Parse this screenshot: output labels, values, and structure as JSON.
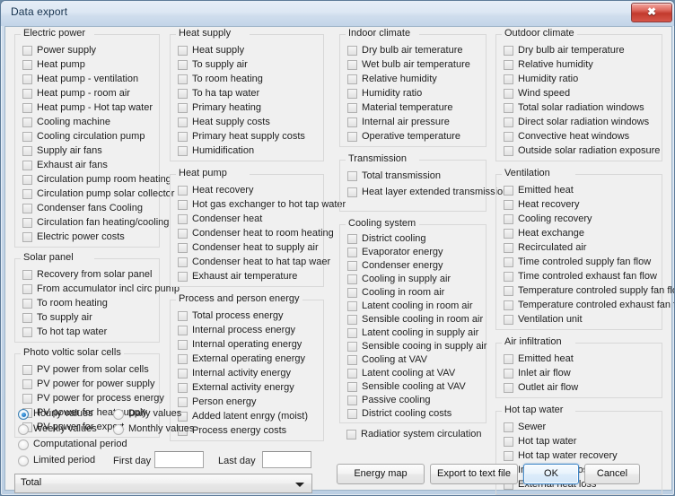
{
  "window": {
    "title": "Data export",
    "close_label": "✖",
    "close_icon": "close-icon"
  },
  "groups": {
    "electric_power": {
      "title": "Electric power",
      "items": [
        "Power supply",
        "Heat pump",
        "Heat pump - ventilation",
        "Heat pump - room air",
        "Heat pump - Hot tap water",
        "Cooling machine",
        "Cooling circulation pump",
        "Supply air fans",
        "Exhaust air fans",
        "Circulation pump room heating",
        "Circulation pump solar collector",
        "Condenser fans Cooling",
        "Circulation fan heating/cooling",
        "Electric power costs"
      ]
    },
    "solar_panel": {
      "title": "Solar panel",
      "items": [
        "Recovery from solar panel",
        "From accumulator incl circ pump",
        "To room heating",
        "To supply air",
        "To hot tap water"
      ]
    },
    "photo_voltic": {
      "title": "Photo voltic solar cells",
      "items": [
        "PV power from solar cells",
        "PV power for power supply",
        "PV power for process energy",
        "PV power for heat supply",
        "PV power for export"
      ]
    },
    "heat_supply": {
      "title": "Heat supply",
      "items": [
        "Heat supply",
        "To supply air",
        "To room heating",
        "To ha tap water",
        "Primary heating",
        "Heat supply costs",
        "Primary heat supply costs",
        "Humidification"
      ]
    },
    "heat_pump": {
      "title": "Heat pump",
      "items": [
        "Heat recovery",
        "Hot gas exchanger to hot tap water",
        "Condenser heat",
        "Condenser heat to room heating",
        "Condenser heat to supply air",
        "Condenser heat to hat tap waer",
        "Exhaust air temperature"
      ]
    },
    "process_person_energy": {
      "title": "Process and person energy",
      "items": [
        "Total process energy",
        "Internal process energy",
        "Internal operating energy",
        "External operating energy",
        "Internal activity energy",
        "External activity energy",
        "Person energy",
        "Added latent enrgy (moist)",
        "Process energy costs"
      ]
    },
    "indoor_climate": {
      "title": "Indoor climate",
      "items": [
        "Dry bulb air temerature",
        "Wet bulb air temperature",
        "Relative humidity",
        "Humidity ratio",
        "Material temperature",
        "Internal air pressure",
        "Operative temperature"
      ]
    },
    "transmission": {
      "title": "Transmission",
      "items": [
        "Total transmission",
        "Heat layer extended transmission"
      ]
    },
    "cooling_system": {
      "title": "Cooling system",
      "items": [
        "District cooling",
        "Evaporator energy",
        "Condenser energy",
        "Cooling in supply air",
        "Cooling in room air",
        "Latent cooling in room air",
        "Sensible cooling in room air",
        "Latent cooling in supply air",
        "Sensible cooing in supply air",
        "Cooling at VAV",
        "Latent cooling at VAV",
        "Sensible cooling at VAV",
        "Passive cooling",
        "District cooling costs"
      ]
    },
    "outdoor_climate": {
      "title": "Outdoor climate",
      "items": [
        "Dry bulb air temperature",
        "Relative humidity",
        "Humidity ratio",
        "Wind speed",
        "Total solar radiation windows",
        "Direct solar radiation windows",
        "Convective heat windows",
        "Outside solar radiation exposure"
      ]
    },
    "ventilation": {
      "title": "Ventilation",
      "items": [
        "Emitted heat",
        "Heat recovery",
        "Cooling recovery",
        "Heat exchange",
        "Recirculated air",
        "Time controled supply fan flow",
        "Time controled exhaust fan flow",
        "Temperature controled supply fan flow",
        "Temperature controled exhaust fan flow",
        "Ventilation unit"
      ]
    },
    "air_infiltration": {
      "title": "Air infiltration",
      "items": [
        "Emitted heat",
        "Inlet air flow",
        "Outlet air flow"
      ]
    },
    "hot_tap_water": {
      "title": "Hot tap water",
      "items": [
        "Sewer",
        "Hot tap water",
        "Hot tap water recovery",
        "Internal heat loss",
        "External heat loss"
      ]
    }
  },
  "standalone": {
    "radiator_system_circulation": "Radiatior system circulation"
  },
  "interval": {
    "options": [
      "Hourly values",
      "Daily values",
      "Weekly values",
      "Monthly values",
      "Computational period",
      "Limited period"
    ],
    "selected": "Hourly values"
  },
  "period": {
    "first_day_label": "First day",
    "first_day_value": "",
    "last_day_label": "Last day",
    "last_day_value": ""
  },
  "scope_combo": {
    "selected": "Total",
    "options": [
      "Total"
    ]
  },
  "buttons": {
    "energy_map": "Energy map",
    "export_to_text_file": "Export to text file",
    "ok": "OK",
    "cancel": "Cancel"
  }
}
